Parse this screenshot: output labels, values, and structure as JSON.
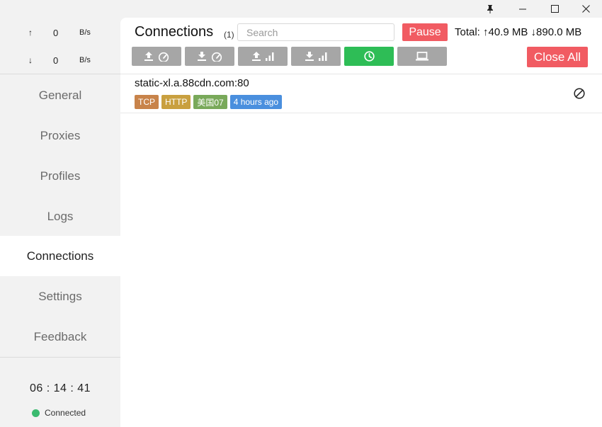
{
  "window": {
    "pin_icon": "pin-icon",
    "minimize_icon": "minimize-icon",
    "maximize_icon": "maximize-icon",
    "close_icon": "close-icon"
  },
  "sidebar": {
    "upload": {
      "arrow": "↑",
      "value": "0",
      "unit": "B/s"
    },
    "download": {
      "arrow": "↓",
      "value": "0",
      "unit": "B/s"
    },
    "items": [
      {
        "label": "General"
      },
      {
        "label": "Proxies"
      },
      {
        "label": "Profiles"
      },
      {
        "label": "Logs"
      },
      {
        "label": "Connections",
        "active": true
      },
      {
        "label": "Settings"
      },
      {
        "label": "Feedback"
      }
    ],
    "clock": "06 : 14 : 41",
    "status": "Connected",
    "status_color": "#3aba6f"
  },
  "main": {
    "title": "Connections",
    "count": "(1)",
    "search_placeholder": "Search",
    "pause_label": "Pause",
    "total": "Total: ↑40.9 MB ↓890.0 MB",
    "close_all_label": "Close All",
    "sort_buttons": [
      {
        "name": "upload-speed",
        "icons": [
          "upload-icon",
          "speedometer-icon"
        ],
        "active": false
      },
      {
        "name": "download-speed",
        "icons": [
          "download-icon",
          "speedometer-icon"
        ],
        "active": false
      },
      {
        "name": "upload-total",
        "icons": [
          "upload-icon",
          "bar-chart-icon"
        ],
        "active": false
      },
      {
        "name": "download-total",
        "icons": [
          "download-icon",
          "bar-chart-icon"
        ],
        "active": false
      },
      {
        "name": "time",
        "icons": [
          "clock-icon"
        ],
        "active": true
      },
      {
        "name": "source",
        "icons": [
          "laptop-icon"
        ],
        "active": false
      }
    ],
    "colors": {
      "accent_red": "#f15b62",
      "active_green": "#2ebd56",
      "inactive_gray": "#a6a6a6"
    },
    "connections": [
      {
        "host": "static-xl.a.88cdn.com:80",
        "tags": [
          {
            "text": "TCP",
            "color": "#c8834a"
          },
          {
            "text": "HTTP",
            "color": "#c9a03f"
          },
          {
            "text": "美国07",
            "color": "#79a95a"
          },
          {
            "text": "4 hours ago",
            "color": "#4a8fde"
          }
        ],
        "close_icon": "cancel-circle-icon"
      }
    ]
  }
}
